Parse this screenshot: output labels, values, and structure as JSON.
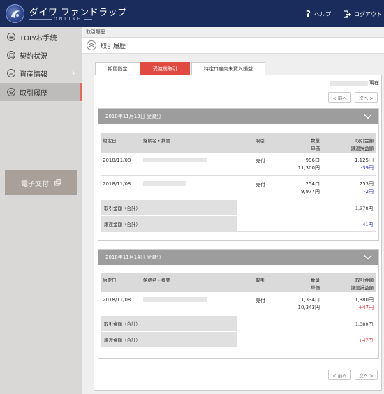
{
  "header": {
    "brand": "ダイワ ファンドラップ",
    "brand_sub": "ONLINE",
    "help_label": "ヘルプ",
    "logout_label": "ログアウト"
  },
  "sidebar": {
    "items": [
      {
        "label": "TOP/お手続",
        "icon": "home-icon"
      },
      {
        "label": "契約状況",
        "icon": "contract-icon"
      },
      {
        "label": "資産情報",
        "icon": "chart-icon"
      },
      {
        "label": "取引履歴",
        "icon": "layers-icon"
      }
    ],
    "ebook_label": "電子交付"
  },
  "main": {
    "breadcrumb": "取引履歴",
    "title": "取引履歴",
    "tabs": [
      {
        "label": "期間指定"
      },
      {
        "label": "受渡前取引"
      },
      {
        "label": "特定口座内未買入損益"
      }
    ],
    "as_of_suffix": "現在",
    "prev_label": "< 前へ",
    "next_label": "次へ >",
    "columns": {
      "date": "約定日",
      "name": "銘柄名・摘要",
      "trade": "取引",
      "qty": "数量",
      "unit_price": "単価",
      "amount": "取引金額",
      "gain": "譲渡損益額"
    },
    "groups": [
      {
        "title": "2018年11月13日 受渡分",
        "rows": [
          {
            "date": "2018/11/08",
            "trade": "売付",
            "qty": "996口",
            "price": "11,300円",
            "amount": "1,125円",
            "gain": "-39円"
          },
          {
            "date": "2018/11/08",
            "trade": "売付",
            "qty": "254口",
            "price": "9,977円",
            "amount": "253円",
            "gain": "-2円"
          }
        ],
        "total_amount_label": "取引金額（合計）",
        "total_amount": "1,378円",
        "total_gain_label": "譲渡金額（合計）",
        "total_gain": "-41円"
      },
      {
        "title": "2018年11月14日 受渡分",
        "rows": [
          {
            "date": "2018/11/08",
            "trade": "売付",
            "qty": "1,334口",
            "price": "10,343円",
            "amount": "1,380円",
            "gain": "+47円"
          }
        ],
        "total_amount_label": "取引金額（合計）",
        "total_amount": "1,380円",
        "total_gain_label": "譲渡金額（合計）",
        "total_gain": "+47円"
      }
    ]
  },
  "colors": {
    "header_bg": "#1a2c5b",
    "active_tab": "#e04a40",
    "negative": "#2233cc",
    "positive": "#e0201a"
  }
}
